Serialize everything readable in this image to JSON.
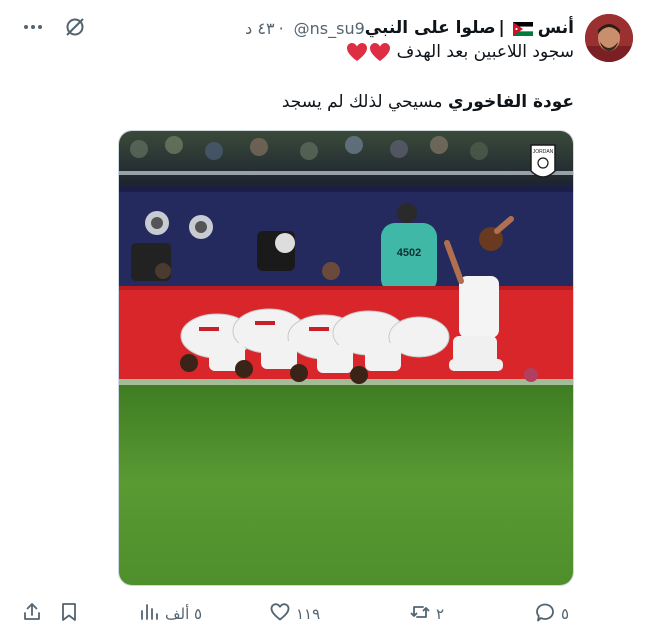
{
  "tweet": {
    "author_name": "أنس",
    "display_name": "صلوا على النبي",
    "separator": "|",
    "handle": "@ns_su9",
    "dot": "·",
    "time": "٤٣ د",
    "text_line1": "سجود اللاعبين بعد الهدف",
    "text_line2_bold": "عودة الفاخوري",
    "text_line2_rest": " مسيحي لذلك لم يسجد"
  },
  "media": {
    "board_number": "4502",
    "badge_label": "JORDAN"
  },
  "actions": {
    "replies": "٥",
    "retweets": "٢",
    "likes": "١١٩",
    "views": "٥ ألف"
  },
  "colors": {
    "accent_red": "#e0245e",
    "muted": "#536471",
    "pitch_green": "#4e8f2c",
    "ad_board_red": "#d8262a"
  },
  "icons": [
    "more-icon",
    "grok-icon",
    "jordan-flag-icon",
    "heart-emoji-icon",
    "reply-icon",
    "retweet-icon",
    "like-icon",
    "views-icon",
    "bookmark-icon",
    "share-icon"
  ]
}
